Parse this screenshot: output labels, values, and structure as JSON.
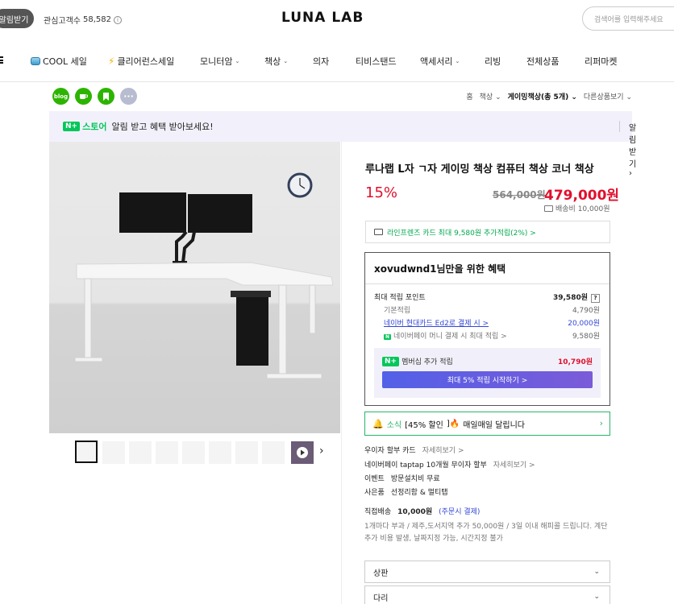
{
  "topbar": {
    "alarm_label": "알림받기",
    "favorite_label": "관심고객수",
    "favorite_count": "58,582",
    "logo": "LUNA LAB",
    "search_placeholder": "검색어를 입력해주세요"
  },
  "nav": {
    "items": [
      {
        "label": "COOL 세일"
      },
      {
        "label": "클리어런스세일"
      },
      {
        "label": "모니터암"
      },
      {
        "label": "책상"
      },
      {
        "label": "의자"
      },
      {
        "label": "티비스탠드"
      },
      {
        "label": "액세서리"
      },
      {
        "label": "리빙"
      },
      {
        "label": "전체상품"
      },
      {
        "label": "리퍼마켓"
      }
    ]
  },
  "share": {
    "blog": "blog",
    "more": "···"
  },
  "breadcrumb": {
    "home": "홈",
    "cat1": "책상",
    "cat2": "게이밍책상(총 5개)",
    "other": "다른상품보기"
  },
  "banner": {
    "npay": "N+",
    "store": "스토어",
    "text": "알림 받고 혜택 받아보세요!",
    "button": "알림받기"
  },
  "product": {
    "title": "루나랩 L자 ㄱ자 게이밍 책상 컴퓨터 책상 코너 책상",
    "discount": "15%",
    "original_price": "564,000원",
    "sale_price": "479,000원",
    "shipping_fee": "배송비 10,000원"
  },
  "card_benefit": {
    "text": "라인프렌즈 카드 최대 9,580원 추가적립(2%) >"
  },
  "benefit": {
    "title": "xovudwnd1님만을 위한 혜택",
    "max_label": "최대 적립 포인트",
    "max_value": "39,580원",
    "basic_label": "기본적립",
    "basic_value": "4,790원",
    "hyundai_label": "네이버 현대카드 Ed2로 결제 시 >",
    "hyundai_value": "20,000원",
    "money_label": "네이버페이 머니 결제 시 최대 적립 >",
    "money_value": "9,580원",
    "membership_label": "멤버십 추가 적립",
    "membership_value": "10,790원",
    "membership_button": "최대 5% 적립 시작하기 >"
  },
  "notify": {
    "prefix": "소식",
    "highlight": "[45% 할인",
    "text": "매일매일 달립니다"
  },
  "info_rows": [
    {
      "label": "우이자 할부 카드",
      "more": "자세히보기 >"
    },
    {
      "label": "네이버페이 taptap 10개월 무이자 할부",
      "more": "자세히보기 >"
    },
    {
      "label": "이벤트",
      "more": "방문설치비 무료"
    },
    {
      "label": "사은품",
      "more": "선정리함 & 멀티탭"
    }
  ],
  "shipping_info": {
    "label": "직접배송",
    "fee": "10,000원",
    "link": "(주문시 결제)",
    "desc": "1개마다 부과 / 제주,도서지역 추가 50,000원 / 3일 이내 해피콜 드립니다. 계단 추가 비용 발생, 날짜지정 가능, 시간지정 불가"
  },
  "options": {
    "top": "상판",
    "legs": "다리"
  }
}
